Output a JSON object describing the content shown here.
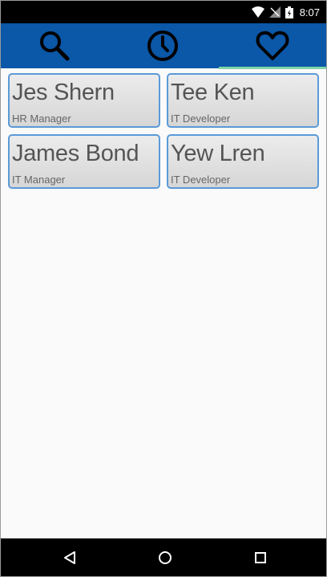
{
  "status_bar": {
    "time": "8:07",
    "icons": [
      "wifi-icon",
      "signal-icon",
      "battery-icon"
    ]
  },
  "tabs": [
    {
      "icon": "search-icon",
      "selected": false
    },
    {
      "icon": "clock-icon",
      "selected": false
    },
    {
      "icon": "heart-icon",
      "selected": true
    }
  ],
  "contacts": [
    {
      "name": "Jes Shern",
      "role": "HR Manager"
    },
    {
      "name": "Tee Ken",
      "role": "IT Developer"
    },
    {
      "name": "James Bond",
      "role": "IT Manager"
    },
    {
      "name": "Yew Lren",
      "role": "IT Developer"
    }
  ],
  "nav_bar": {
    "icons": [
      "back-icon",
      "home-icon",
      "recent-apps-icon"
    ]
  },
  "colors": {
    "tab_bar": "#0b57a8",
    "tab_indicator": "#7ed6a8",
    "card_border": "#5a9ad8"
  }
}
